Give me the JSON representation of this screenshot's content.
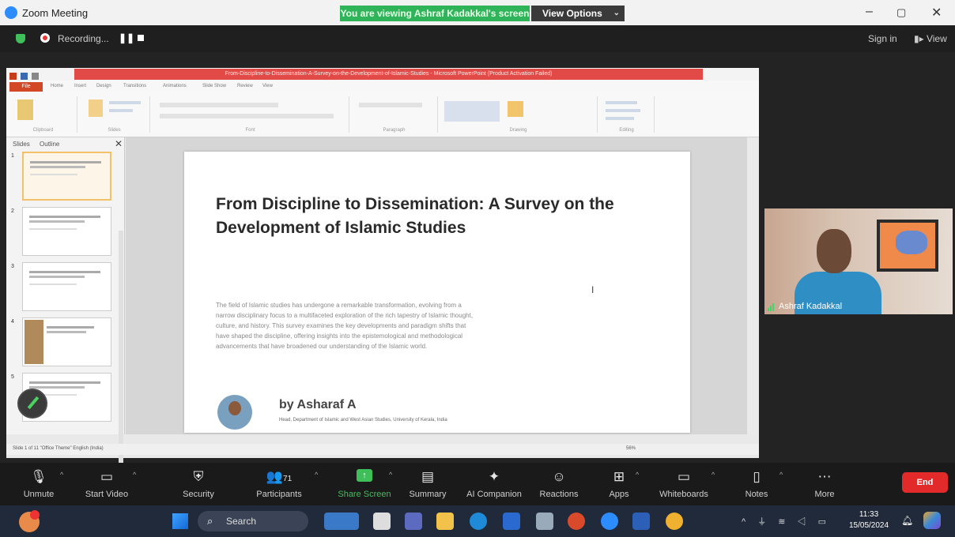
{
  "window": {
    "title": "Zoom Meeting",
    "banner": "You are viewing Ashraf Kadakkal's screen",
    "view_options": "View Options",
    "min": "–",
    "max": "▢",
    "close": "✕"
  },
  "meeting_bar": {
    "recording": "Recording...",
    "pause": "❚❚",
    "sign_in": "Sign in",
    "view": "View"
  },
  "powerpoint": {
    "title_bar": "From-Discipline-to-Dissemination-A-Survey-on-the-Development-of-Islamic-Studies - Microsoft PowerPoint (Product Activation Failed)",
    "tabs": [
      "File",
      "Home",
      "Insert",
      "Design",
      "Transitions",
      "Animations",
      "Slide Show",
      "Review",
      "View"
    ],
    "ribbon_groups": [
      "Clipboard",
      "Slides",
      "Font",
      "Paragraph",
      "Drawing",
      "Editing"
    ],
    "pane_tabs": [
      "Slides",
      "Outline"
    ],
    "pane_close": "✕",
    "thumbnail_numbers": [
      "1",
      "2",
      "3",
      "4",
      "5"
    ],
    "status_left": "Slide 1 of 11   \"Office Theme\"   English (India)",
    "status_zoom": "56%"
  },
  "slide": {
    "title": "From Discipline to Dissemination: A Survey on the Development of Islamic Studies",
    "body": "The field of Islamic studies has undergone a remarkable transformation, evolving from a narrow disciplinary focus to a multifaceted exploration of the rich tapestry of Islamic thought, culture, and history. This survey examines the key developments and paradigm shifts that have shaped the discipline, offering insights into the epistemological and methodological advancements that have broadened our understanding of the Islamic world.",
    "author": "by Asharaf A",
    "affiliation": "Head, Department of Islamic and West Asian Studies, University of Kerala, India"
  },
  "video": {
    "participant_name": "Ashraf Kadakkal"
  },
  "toolbar": {
    "unmute": "Unmute",
    "start_video": "Start Video",
    "security": "Security",
    "participants": "Participants",
    "participant_count": "71",
    "share_screen": "Share Screen",
    "summary": "Summary",
    "ai_companion": "AI Companion",
    "reactions": "Reactions",
    "apps": "Apps",
    "whiteboards": "Whiteboards",
    "notes": "Notes",
    "more": "More",
    "end": "End"
  },
  "taskbar": {
    "search": "Search",
    "time": "11:33",
    "date": "15/05/2024"
  }
}
